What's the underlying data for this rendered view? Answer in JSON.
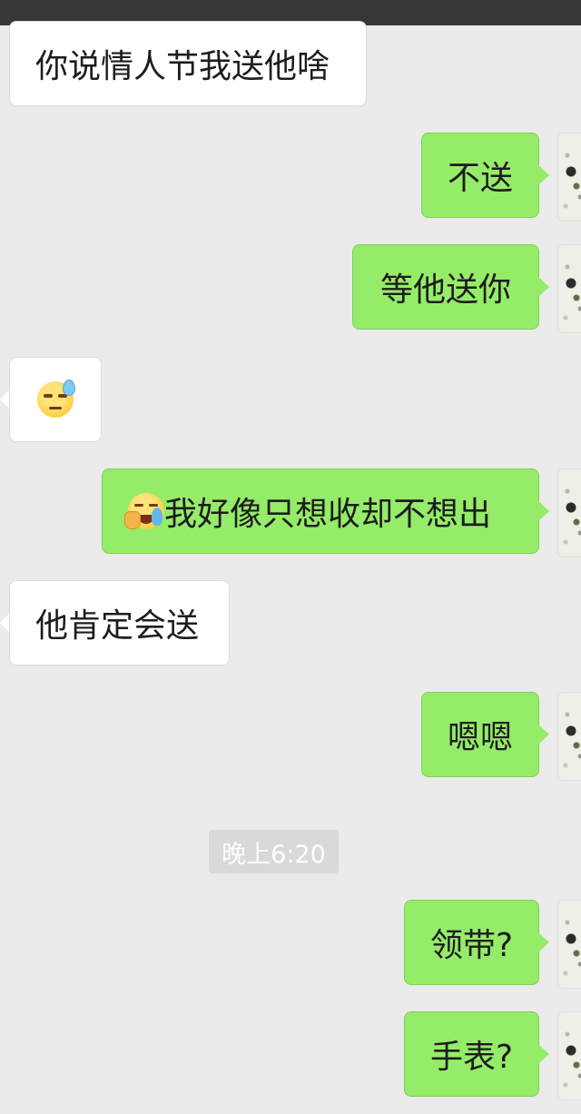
{
  "status_bar": {},
  "messages": [
    {
      "side": "incoming",
      "text": "你说情人节我送他啥"
    },
    {
      "side": "outgoing",
      "text": "不送"
    },
    {
      "side": "outgoing",
      "text": "等他送你"
    },
    {
      "side": "incoming",
      "emoji": "sweat-face-emoji",
      "text": ""
    },
    {
      "side": "outgoing",
      "emoji": "crying-face-emoji",
      "text": "我好像只想收却不想出"
    },
    {
      "side": "incoming",
      "text": "他肯定会送"
    },
    {
      "side": "outgoing",
      "text": "嗯嗯"
    },
    {
      "side": "outgoing",
      "text": "领带?"
    },
    {
      "side": "outgoing",
      "text": "手表?"
    }
  ],
  "timestamp": "晚上6:20",
  "colors": {
    "background": "#ebebeb",
    "incoming_bubble": "#ffffff",
    "outgoing_bubble": "#95ec69",
    "status_bar": "#35373a",
    "timestamp_bg": "#d9d9d9"
  }
}
